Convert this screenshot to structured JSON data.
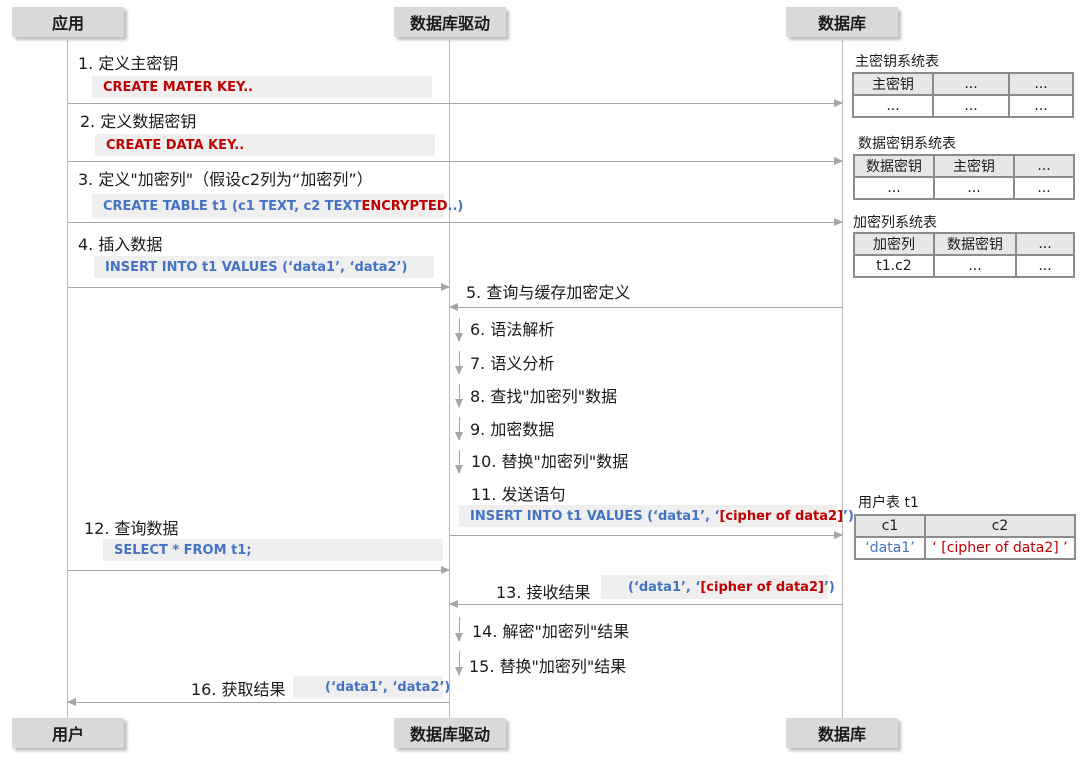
{
  "actors": {
    "app": "应用",
    "driver_top": "数据库驱动",
    "db_top": "数据库",
    "user": "用户",
    "driver_bottom": "数据库驱动",
    "db_bottom": "数据库"
  },
  "steps": [
    {
      "label": "1. 定义主密钥",
      "code": "CREATE MATER KEY.."
    },
    {
      "label": "2. 定义数据密钥",
      "code": "CREATE DATA KEY.."
    },
    {
      "label": "3. 定义\"加密列\"（假设c2列为“加密列”）",
      "code_a": "CREATE TABLE t1 (c1 TEXT, c2 TEXT ",
      "code_b": "ENCRYPTED",
      "code_c": " ..)"
    },
    {
      "label": "4. 插入数据",
      "code": "INSERT INTO t1 VALUES (‘data1’, ‘data2’)"
    },
    {
      "label": "5. 查询与缓存加密定义"
    },
    {
      "label": "6. 语法解析"
    },
    {
      "label": "7. 语义分析"
    },
    {
      "label": "8. 查找\"加密列\"数据"
    },
    {
      "label": "9. 加密数据"
    },
    {
      "label": "10. 替换\"加密列\"数据"
    },
    {
      "label": "11. 发送语句",
      "code_a": "INSERT INTO t1 VALUES (‘data1’, ‘ ",
      "code_b": "[cipher of data2]",
      "code_c": " ’)"
    },
    {
      "label": "12. 查询数据",
      "code": "SELECT * FROM t1;"
    },
    {
      "label": "13. 接收结果",
      "code_a": "(‘data1’, ‘ ",
      "code_b": "[cipher of data2]",
      "code_c": " ’)"
    },
    {
      "label": "14. 解密\"加密列\"结果"
    },
    {
      "label": "15. 替换\"加密列\"结果"
    },
    {
      "label": "16. 获取结果",
      "code": "(‘data1’, ‘data2’)"
    }
  ],
  "tables": {
    "master": {
      "title": "主密钥系统表",
      "header": [
        "主密钥",
        "...",
        "..."
      ],
      "row": [
        "...",
        "...",
        "..."
      ]
    },
    "datakey": {
      "title": "数据密钥系统表",
      "header": [
        "数据密钥",
        "主密钥",
        "..."
      ],
      "row": [
        "...",
        "...",
        "..."
      ]
    },
    "enccol": {
      "title": "加密列系统表",
      "header": [
        "加密列",
        "数据密钥",
        "..."
      ],
      "row": [
        "t1.c2",
        "...",
        "..."
      ]
    },
    "user": {
      "title": "用户表 t1",
      "header": [
        "c1",
        "c2"
      ],
      "row_c1": "‘data1’",
      "row_c2": "‘ [cipher of data2] ’"
    }
  },
  "colors": {
    "code_blue": "#4472c4",
    "code_red": "#c00000",
    "actor_bg": "#d9d9d9",
    "line": "#a6a6a6"
  }
}
